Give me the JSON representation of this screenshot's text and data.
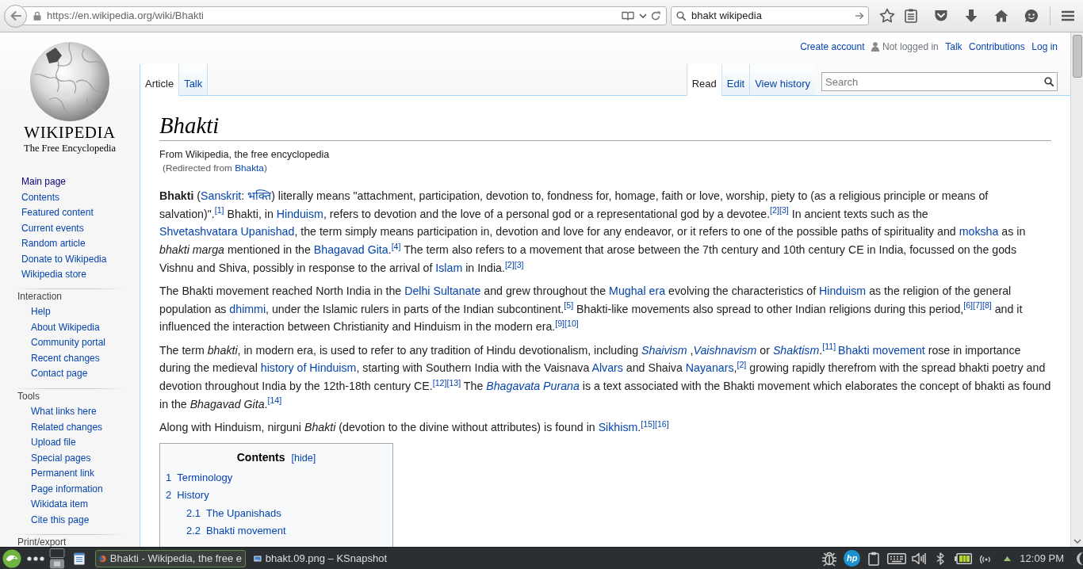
{
  "browser": {
    "url": "https://en.wikipedia.org/wiki/Bhakti",
    "search_value": "bhakt wikipedia"
  },
  "sidebar": {
    "wordmark": "WIKIPEDIA",
    "tagline": "The Free Encyclopedia",
    "navigation": [
      {
        "label": "Main page",
        "visited": true
      },
      {
        "label": "Contents",
        "visited": false
      },
      {
        "label": "Featured content",
        "visited": false
      },
      {
        "label": "Current events",
        "visited": false
      },
      {
        "label": "Random article",
        "visited": false
      },
      {
        "label": "Donate to Wikipedia",
        "visited": false
      },
      {
        "label": "Wikipedia store",
        "visited": false
      }
    ],
    "portals": [
      {
        "heading": "Interaction",
        "items": [
          {
            "label": "Help",
            "visited": false
          },
          {
            "label": "About Wikipedia",
            "visited": false
          },
          {
            "label": "Community portal",
            "visited": false
          },
          {
            "label": "Recent changes",
            "visited": false
          },
          {
            "label": "Contact page",
            "visited": false
          }
        ]
      },
      {
        "heading": "Tools",
        "items": [
          {
            "label": "What links here",
            "visited": false
          },
          {
            "label": "Related changes",
            "visited": false
          },
          {
            "label": "Upload file",
            "visited": false
          },
          {
            "label": "Special pages",
            "visited": false
          },
          {
            "label": "Permanent link",
            "visited": false
          },
          {
            "label": "Page information",
            "visited": false
          },
          {
            "label": "Wikidata item",
            "visited": false
          },
          {
            "label": "Cite this page",
            "visited": false
          }
        ]
      },
      {
        "heading": "Print/export"
      }
    ]
  },
  "personal_links": [
    {
      "kind": "link",
      "label": "Create account"
    },
    {
      "kind": "user",
      "label": "Not logged in"
    },
    {
      "kind": "link",
      "label": "Talk"
    },
    {
      "kind": "link",
      "label": "Contributions"
    },
    {
      "kind": "link",
      "label": "Log in"
    }
  ],
  "namespace_tabs": [
    {
      "label": "Article",
      "selected": true
    },
    {
      "label": "Talk",
      "selected": false
    }
  ],
  "view_tabs": [
    {
      "label": "Read",
      "selected": true
    },
    {
      "label": "Edit",
      "selected": false
    },
    {
      "label": "View history",
      "selected": false
    }
  ],
  "search": {
    "placeholder": "Search"
  },
  "article": {
    "title": "Bhakti",
    "tagline": "From Wikipedia, the free encyclopedia",
    "redirect": [
      {
        "kind": "text",
        "text": "(Redirected from "
      },
      {
        "kind": "link",
        "text": "Bhakta"
      },
      {
        "kind": "text",
        "text": ")"
      }
    ],
    "paragraphs": [
      [
        {
          "kind": "text",
          "text": "**Bhakti** ("
        },
        {
          "kind": "link",
          "text": "Sanskrit"
        },
        {
          "kind": "text",
          "text": ": "
        },
        {
          "kind": "link",
          "text": "भक्ति"
        },
        {
          "kind": "text",
          "text": ") literally means \"attachment, participation, devotion to, fondness for, homage, faith or love, worship, piety to (as a religious principle or means of salvation)\"."
        },
        {
          "kind": "ref",
          "text": "[1]"
        },
        {
          "kind": "text",
          "text": " Bhakti, in "
        },
        {
          "kind": "link",
          "text": "Hinduism"
        },
        {
          "kind": "text",
          "text": ", refers to devotion and the love of a personal god or a representational god by a devotee."
        },
        {
          "kind": "ref",
          "text": "[2]"
        },
        {
          "kind": "ref",
          "text": "[3]"
        },
        {
          "kind": "text",
          "text": " In ancient texts such as the "
        },
        {
          "kind": "link",
          "text": "Shvetashvatara Upanishad"
        },
        {
          "kind": "text",
          "text": ", the term simply means participation in, devotion and love for any endeavor, or it refers to one of the possible paths of spirituality and "
        },
        {
          "kind": "link",
          "text": "moksha"
        },
        {
          "kind": "text",
          "text": " as in *bhakti marga* mentioned in the "
        },
        {
          "kind": "link",
          "text": "Bhagavad Gita"
        },
        {
          "kind": "text",
          "text": "."
        },
        {
          "kind": "ref",
          "text": "[4]"
        },
        {
          "kind": "text",
          "text": " The term also refers to a movement that arose between the 7th century and 10th century CE in India, focussed on the gods Vishnu and Shiva, possibly in response to the arrival of "
        },
        {
          "kind": "link",
          "text": "Islam"
        },
        {
          "kind": "text",
          "text": " in India."
        },
        {
          "kind": "ref",
          "text": "[2]"
        },
        {
          "kind": "ref",
          "text": "[3]"
        }
      ],
      [
        {
          "kind": "text",
          "text": "The Bhakti movement reached North India in the "
        },
        {
          "kind": "link",
          "text": "Delhi Sultanate"
        },
        {
          "kind": "text",
          "text": " and grew throughout the "
        },
        {
          "kind": "link",
          "text": "Mughal era"
        },
        {
          "kind": "text",
          "text": " evolving the characteristics of "
        },
        {
          "kind": "link",
          "text": "Hinduism"
        },
        {
          "kind": "text",
          "text": " as the religion of the general population as "
        },
        {
          "kind": "link",
          "text": "dhimmi"
        },
        {
          "kind": "text",
          "text": ", under the Islamic rulers in parts of the Indian subcontinent."
        },
        {
          "kind": "ref",
          "text": "[5]"
        },
        {
          "kind": "text",
          "text": " Bhakti-like movements also spread to other Indian religions during this period,"
        },
        {
          "kind": "ref",
          "text": "[6]"
        },
        {
          "kind": "ref",
          "text": "[7]"
        },
        {
          "kind": "ref",
          "text": "[8]"
        },
        {
          "kind": "text",
          "text": " and it influenced the interaction between Christianity and Hinduism in the modern era."
        },
        {
          "kind": "ref",
          "text": "[9]"
        },
        {
          "kind": "ref",
          "text": "[10]"
        }
      ],
      [
        {
          "kind": "text",
          "text": "The term *bhakti*, in modern era, is used to refer to any tradition of Hindu devotionalism, including "
        },
        {
          "kind": "ilink",
          "text": "Shaivism"
        },
        {
          "kind": "text",
          "text": " ,"
        },
        {
          "kind": "ilink",
          "text": "Vaishnavism"
        },
        {
          "kind": "text",
          "text": " or "
        },
        {
          "kind": "ilink",
          "text": "Shaktism"
        },
        {
          "kind": "text",
          "text": "."
        },
        {
          "kind": "ref",
          "text": "[11] "
        },
        {
          "kind": "link",
          "text": "Bhakti movement"
        },
        {
          "kind": "text",
          "text": " rose in importance during the medieval "
        },
        {
          "kind": "link",
          "text": "history of Hinduism"
        },
        {
          "kind": "text",
          "text": ", starting with Southern India with the Vaisnava "
        },
        {
          "kind": "link",
          "text": "Alvars"
        },
        {
          "kind": "text",
          "text": " and Shaiva "
        },
        {
          "kind": "link",
          "text": "Nayanars"
        },
        {
          "kind": "text",
          "text": ","
        },
        {
          "kind": "ref",
          "text": "[2]"
        },
        {
          "kind": "text",
          "text": " growing rapidly therefrom with the spread bhakti poetry and devotion throughout India by the 12th-18th century CE."
        },
        {
          "kind": "ref",
          "text": "[12]"
        },
        {
          "kind": "ref",
          "text": "[13]"
        },
        {
          "kind": "text",
          "text": " The "
        },
        {
          "kind": "ilink",
          "text": "Bhagavata Purana"
        },
        {
          "kind": "text",
          "text": " is a text associated with the Bhakti movement which elaborates the concept of bhakti as found in the *Bhagavad Gita*."
        },
        {
          "kind": "ref",
          "text": "[14]"
        }
      ],
      [
        {
          "kind": "text",
          "text": "Along with Hinduism, nirguni *Bhakti* (devotion to the divine without attributes) is found in "
        },
        {
          "kind": "link",
          "text": "Sikhism"
        },
        {
          "kind": "text",
          "text": "."
        },
        {
          "kind": "ref",
          "text": "[15]"
        },
        {
          "kind": "ref",
          "text": "[16]"
        }
      ]
    ],
    "contents": {
      "title": "Contents",
      "toggle": "[hide]",
      "items": [
        {
          "number": "1",
          "title": "Terminology"
        },
        {
          "number": "2",
          "title": "History",
          "children": [
            {
              "number": "2.1",
              "title": "The Upanishads"
            },
            {
              "number": "2.2",
              "title": "Bhakti movement"
            }
          ]
        }
      ]
    }
  },
  "taskbar": {
    "tasks": [
      {
        "kind": "browser",
        "label": "Bhakti - Wikipedia, the free e",
        "selected": true
      },
      {
        "kind": "image",
        "label": "bhakt.09.png – KSnapshot",
        "selected": false
      }
    ],
    "tray_badge": "hp",
    "clock": "12:09 PM"
  }
}
